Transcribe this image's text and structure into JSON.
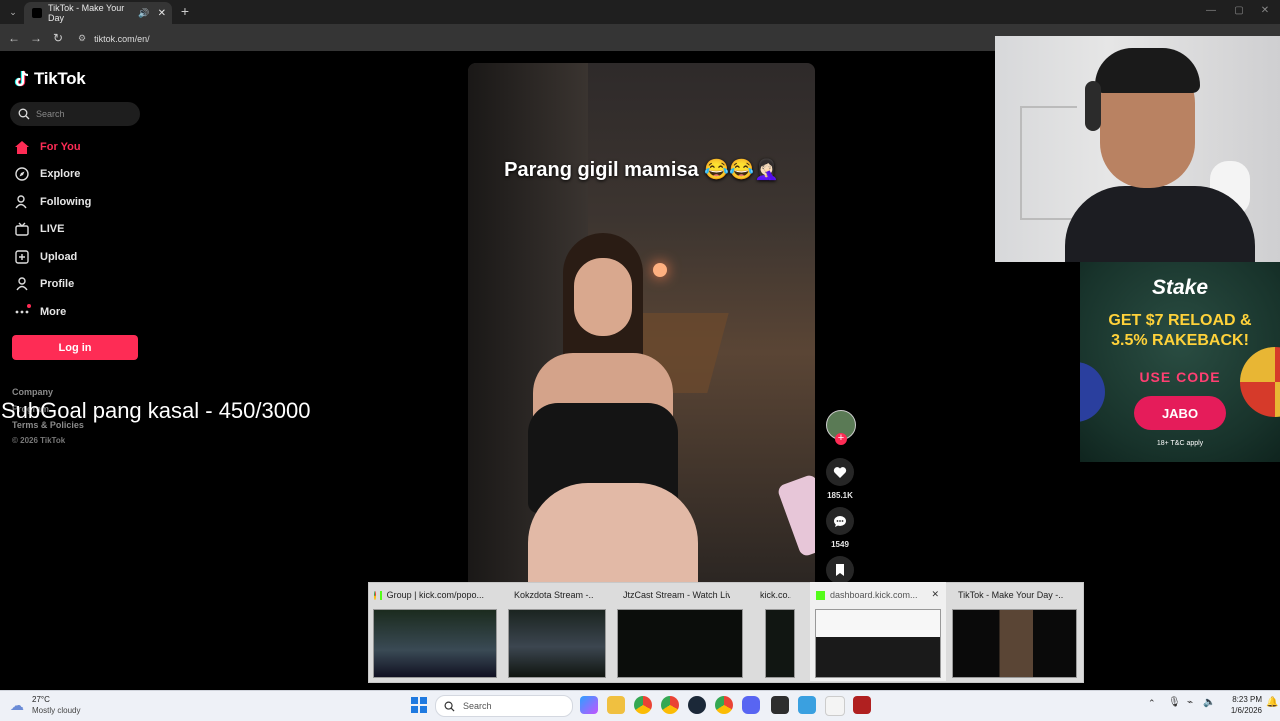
{
  "browser": {
    "tab_title": "TikTok - Make Your Day",
    "url": "tiktok.com/en/"
  },
  "sidebar": {
    "logo": "TikTok",
    "search_placeholder": "Search",
    "items": [
      {
        "label": "For You",
        "icon": "home-icon",
        "active": true
      },
      {
        "label": "Explore",
        "icon": "compass-icon"
      },
      {
        "label": "Following",
        "icon": "following-icon"
      },
      {
        "label": "LIVE",
        "icon": "live-icon"
      },
      {
        "label": "Upload",
        "icon": "upload-icon"
      },
      {
        "label": "Profile",
        "icon": "profile-icon"
      },
      {
        "label": "More",
        "icon": "more-icon"
      }
    ],
    "login_label": "Log in",
    "footer": {
      "company": "Company",
      "program": "Program",
      "terms": "Terms & Policies",
      "copyright": "© 2026 TikTok"
    }
  },
  "overlay": {
    "subgoal": "SubGoal pang kasal - 450/3000"
  },
  "video": {
    "caption": "Parang gigil mamisa 😂😂🤦🏻‍♀️",
    "likes": "185.1K",
    "comments": "1549"
  },
  "ad": {
    "brand": "Stake",
    "headline1": "GET $7 RELOAD &",
    "headline2": "3.5% RAKEBACK!",
    "use_code": "USE CODE",
    "code": "JABO",
    "disclaimer": "18+ T&C apply"
  },
  "previews": [
    {
      "title": "Group | kick.com/popo..."
    },
    {
      "title": "Kokzdota Stream -..."
    },
    {
      "title": "JtzCast Stream - Watch Liv..."
    },
    {
      "title": "kick.co..."
    },
    {
      "title": "dashboard.kick.com..."
    },
    {
      "title": "TikTok - Make Your Day -..."
    }
  ],
  "taskbar": {
    "weather_temp": "27°C",
    "weather_desc": "Mostly cloudy",
    "search_placeholder": "Search",
    "time": "8:23 PM",
    "date": "1/6/2026"
  },
  "colors": {
    "accent": "#fe2c55",
    "chrome_dark": "#1f1f1f",
    "ad_green": "#1b3a32",
    "ad_headline": "#ffd23a"
  }
}
